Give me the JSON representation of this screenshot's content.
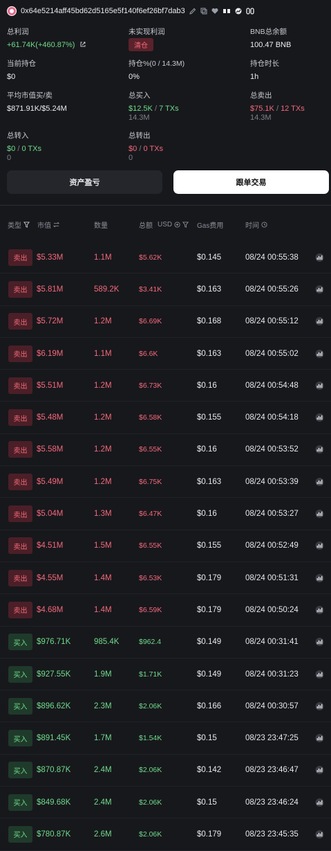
{
  "wallet": {
    "address": "0x64e5214aff45bd62d5165e5f140f6ef26bf7dab3"
  },
  "stats": {
    "total_profit_label": "总利润",
    "total_profit_value": "+61.74K(+460.87%)",
    "unrealized_label": "未实现利润",
    "unrealized_badge": "清仓",
    "bnb_balance_label": "BNB总余额",
    "bnb_balance_value": "100.47 BNB",
    "holding_label": "当前持仓",
    "holding_value": "$0",
    "holding_pct_label": "持仓%(0 / 14.3M)",
    "holding_pct_value": "0%",
    "holding_time_label": "持仓时长",
    "holding_time_value": "1h",
    "avg_mcap_label": "平均市值买/卖",
    "avg_mcap_value": "$871.91K/$5.24M",
    "total_buy_label": "总买入",
    "total_buy_amount": "$12.5K",
    "total_buy_sep": "/",
    "total_buy_txs": "7 TXs",
    "total_buy_sub": "14.3M",
    "total_sell_label": "总卖出",
    "total_sell_amount": "$75.1K",
    "total_sell_sep": "/",
    "total_sell_txs": "12 TXs",
    "total_sell_sub": "14.3M",
    "transfer_in_label": "总转入",
    "transfer_in_amount": "$0",
    "transfer_in_sep": "/",
    "transfer_in_txs": "0 TXs",
    "transfer_in_sub": "0",
    "transfer_out_label": "总转出",
    "transfer_out_amount": "$0",
    "transfer_out_sep": "/",
    "transfer_out_txs": "0 TXs",
    "transfer_out_sub": "0"
  },
  "tabs": {
    "asset_pnl": "资产盈亏",
    "copy_trade": "跟单交易"
  },
  "table": {
    "headers": {
      "type": "类型",
      "mcap": "市值",
      "qty": "数量",
      "total": "总额",
      "usd": "USD",
      "gas": "Gas费用",
      "time": "时间"
    },
    "rows": [
      {
        "type": "卖出",
        "side": "sell",
        "mcap": "$5.33M",
        "qty": "1.1M",
        "total": "$5.62K",
        "gas": "$0.145",
        "time": "08/24 00:55:38"
      },
      {
        "type": "卖出",
        "side": "sell",
        "mcap": "$5.81M",
        "qty": "589.2K",
        "total": "$3.41K",
        "gas": "$0.163",
        "time": "08/24 00:55:26"
      },
      {
        "type": "卖出",
        "side": "sell",
        "mcap": "$5.72M",
        "qty": "1.2M",
        "total": "$6.69K",
        "gas": "$0.168",
        "time": "08/24 00:55:12"
      },
      {
        "type": "卖出",
        "side": "sell",
        "mcap": "$6.19M",
        "qty": "1.1M",
        "total": "$6.6K",
        "gas": "$0.163",
        "time": "08/24 00:55:02"
      },
      {
        "type": "卖出",
        "side": "sell",
        "mcap": "$5.51M",
        "qty": "1.2M",
        "total": "$6.73K",
        "gas": "$0.16",
        "time": "08/24 00:54:48"
      },
      {
        "type": "卖出",
        "side": "sell",
        "mcap": "$5.48M",
        "qty": "1.2M",
        "total": "$6.58K",
        "gas": "$0.155",
        "time": "08/24 00:54:18"
      },
      {
        "type": "卖出",
        "side": "sell",
        "mcap": "$5.58M",
        "qty": "1.2M",
        "total": "$6.55K",
        "gas": "$0.16",
        "time": "08/24 00:53:52"
      },
      {
        "type": "卖出",
        "side": "sell",
        "mcap": "$5.49M",
        "qty": "1.2M",
        "total": "$6.75K",
        "gas": "$0.163",
        "time": "08/24 00:53:39"
      },
      {
        "type": "卖出",
        "side": "sell",
        "mcap": "$5.04M",
        "qty": "1.3M",
        "total": "$6.47K",
        "gas": "$0.16",
        "time": "08/24 00:53:27"
      },
      {
        "type": "卖出",
        "side": "sell",
        "mcap": "$4.51M",
        "qty": "1.5M",
        "total": "$6.55K",
        "gas": "$0.155",
        "time": "08/24 00:52:49"
      },
      {
        "type": "卖出",
        "side": "sell",
        "mcap": "$4.55M",
        "qty": "1.4M",
        "total": "$6.53K",
        "gas": "$0.179",
        "time": "08/24 00:51:31"
      },
      {
        "type": "卖出",
        "side": "sell",
        "mcap": "$4.68M",
        "qty": "1.4M",
        "total": "$6.59K",
        "gas": "$0.179",
        "time": "08/24 00:50:24"
      },
      {
        "type": "买入",
        "side": "buy",
        "mcap": "$976.71K",
        "qty": "985.4K",
        "total": "$962.4",
        "gas": "$0.149",
        "time": "08/24 00:31:41"
      },
      {
        "type": "买入",
        "side": "buy",
        "mcap": "$927.55K",
        "qty": "1.9M",
        "total": "$1.71K",
        "gas": "$0.149",
        "time": "08/24 00:31:23"
      },
      {
        "type": "买入",
        "side": "buy",
        "mcap": "$896.62K",
        "qty": "2.3M",
        "total": "$2.06K",
        "gas": "$0.166",
        "time": "08/24 00:30:57"
      },
      {
        "type": "买入",
        "side": "buy",
        "mcap": "$891.45K",
        "qty": "1.7M",
        "total": "$1.54K",
        "gas": "$0.15",
        "time": "08/23 23:47:25"
      },
      {
        "type": "买入",
        "side": "buy",
        "mcap": "$870.87K",
        "qty": "2.4M",
        "total": "$2.06K",
        "gas": "$0.142",
        "time": "08/23 23:46:47"
      },
      {
        "type": "买入",
        "side": "buy",
        "mcap": "$849.68K",
        "qty": "2.4M",
        "total": "$2.06K",
        "gas": "$0.15",
        "time": "08/23 23:46:24"
      },
      {
        "type": "买入",
        "side": "buy",
        "mcap": "$780.87K",
        "qty": "2.6M",
        "total": "$2.06K",
        "gas": "$0.179",
        "time": "08/23 23:45:35"
      }
    ]
  },
  "colors": {
    "buy": "#6fdb8a",
    "sell": "#f4687a",
    "background": "#17181c"
  }
}
